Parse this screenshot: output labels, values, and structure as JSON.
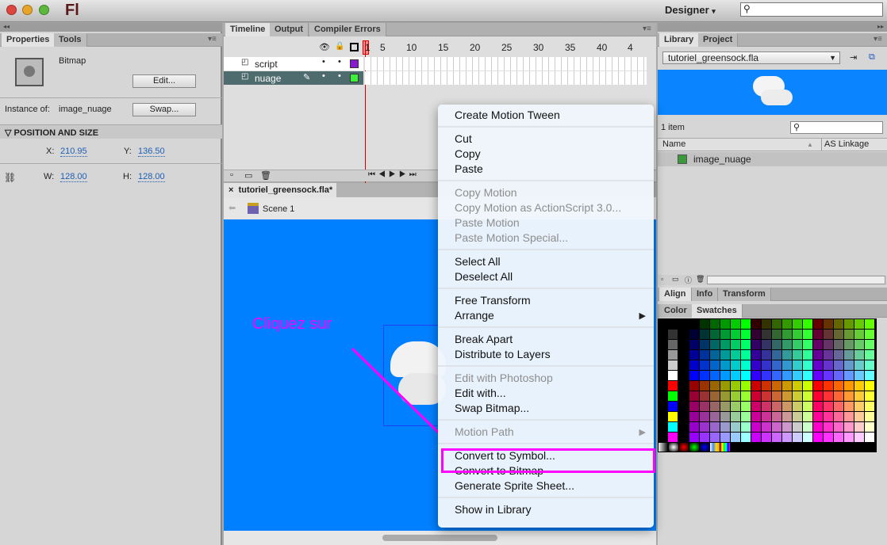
{
  "app": {
    "logo": "Fl",
    "workspace": "Designer",
    "search_placeholder": ""
  },
  "properties": {
    "tabs": [
      "Properties",
      "Tools"
    ],
    "type": "Bitmap",
    "edit": "Edit...",
    "instance_label": "Instance of:",
    "instance_value": "image_nuage",
    "swap": "Swap...",
    "section": "POSITION AND SIZE",
    "x_label": "X:",
    "x": "210.95",
    "y_label": "Y:",
    "y": "136.50",
    "w_label": "W:",
    "w": "128.00",
    "h_label": "H:",
    "h": "128.00"
  },
  "timeline": {
    "tabs": [
      "Timeline",
      "Output",
      "Compiler Errors"
    ],
    "ruler": [
      "1",
      "5",
      "10",
      "15",
      "20",
      "25",
      "30",
      "35",
      "40",
      "4"
    ],
    "layers": [
      {
        "name": "script",
        "color": "#8a1ad0"
      },
      {
        "name": "nuage",
        "color": "#3cf03c"
      }
    ]
  },
  "document": {
    "tab": "tutoriel_greensock.fla*",
    "scene": "Scene 1",
    "stage_color": "#0080ff"
  },
  "annotation": {
    "text": "Cliquez sur",
    "color": "#ff00ff"
  },
  "context_menu": {
    "groups": [
      [
        {
          "label": "Create Motion Tween"
        }
      ],
      [
        {
          "label": "Cut"
        },
        {
          "label": "Copy"
        },
        {
          "label": "Paste"
        }
      ],
      [
        {
          "label": "Copy Motion",
          "disabled": true
        },
        {
          "label": "Copy Motion as ActionScript 3.0...",
          "disabled": true
        },
        {
          "label": "Paste Motion",
          "disabled": true
        },
        {
          "label": "Paste Motion Special...",
          "disabled": true
        }
      ],
      [
        {
          "label": "Select All"
        },
        {
          "label": "Deselect All"
        }
      ],
      [
        {
          "label": "Free Transform"
        },
        {
          "label": "Arrange",
          "submenu": true
        }
      ],
      [
        {
          "label": "Break Apart"
        },
        {
          "label": "Distribute to Layers"
        }
      ],
      [
        {
          "label": "Edit with Photoshop",
          "disabled": true
        },
        {
          "label": "Edit with..."
        },
        {
          "label": "Swap Bitmap..."
        }
      ],
      [
        {
          "label": "Motion Path",
          "disabled": true,
          "submenu": true
        }
      ],
      [
        {
          "label": "Convert to Symbol...",
          "highlighted": true
        },
        {
          "label": "Convert to Bitmap"
        },
        {
          "label": "Generate Sprite Sheet..."
        }
      ],
      [
        {
          "label": "Show in Library"
        }
      ]
    ]
  },
  "library": {
    "tabs": [
      "Library",
      "Project"
    ],
    "file": "tutoriel_greensock.fla",
    "count": "1 item",
    "col_name": "Name",
    "col_linkage": "AS Linkage",
    "items": [
      "image_nuage"
    ]
  },
  "align_tabs": [
    "Align",
    "Info",
    "Transform"
  ],
  "color_tabs": [
    "Color",
    "Swatches"
  ],
  "swatches": {
    "left_column": [
      "#000000",
      "#333333",
      "#666666",
      "#999999",
      "#cccccc",
      "#ffffff",
      "#ff0000",
      "#00ff00",
      "#0000ff",
      "#ffff00",
      "#00ffff",
      "#ff00ff"
    ]
  }
}
